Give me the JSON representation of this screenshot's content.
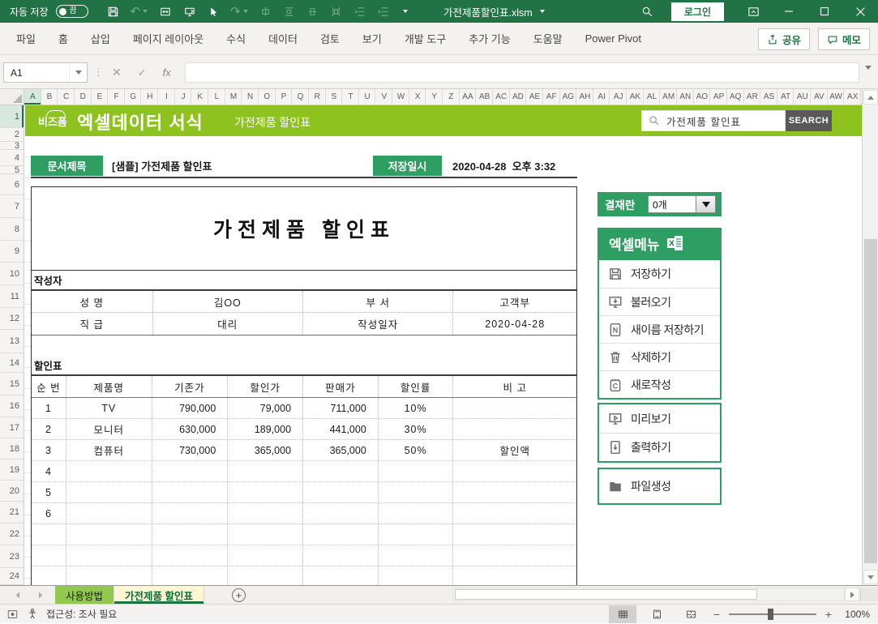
{
  "titlebar": {
    "autosave_label": "자동 저장",
    "autosave_state": "끔",
    "filename": "가전제품할인표.xlsm",
    "login_label": "로그인"
  },
  "ribbon": {
    "tabs": [
      "파일",
      "홈",
      "삽입",
      "페이지 레이아웃",
      "수식",
      "데이터",
      "검토",
      "보기",
      "개발 도구",
      "추가 기능",
      "도움말",
      "Power Pivot"
    ],
    "share_label": "공유",
    "memo_label": "메모"
  },
  "formula_bar": {
    "name_box": "A1",
    "fx_label": "fx",
    "formula_value": ""
  },
  "grid": {
    "columns": [
      "A",
      "B",
      "C",
      "D",
      "E",
      "F",
      "G",
      "H",
      "I",
      "J",
      "K",
      "L",
      "M",
      "N",
      "O",
      "P",
      "Q",
      "R",
      "S",
      "T",
      "U",
      "V",
      "W",
      "X",
      "Y",
      "Z",
      "AA",
      "AB",
      "AC",
      "AD",
      "AE",
      "AF",
      "AG",
      "AH",
      "AI",
      "AJ",
      "AK",
      "AL",
      "AM",
      "AN",
      "AO",
      "AP",
      "AQ",
      "AR",
      "AS",
      "AT",
      "AU",
      "AV",
      "AW",
      "AX"
    ],
    "rows": [
      "1",
      "2",
      "3",
      "4",
      "5",
      "6",
      "7",
      "8",
      "9",
      "10",
      "11",
      "12",
      "13",
      "14",
      "15",
      "16",
      "17",
      "18",
      "19",
      "20",
      "21",
      "22",
      "23",
      "24"
    ],
    "selected_column": "A",
    "selected_row": "1"
  },
  "banner": {
    "logo": "비즈폼",
    "title": "엑셀데이터 서식",
    "subtitle": "가전제품 할인표",
    "search_value": "가전제품 할인표",
    "search_button": "SEARCH",
    "color": "#8dc21f"
  },
  "doc_header": {
    "title_label": "문서제목",
    "title_value": "[샘플] 가전제품 할인표",
    "saved_label": "저장일시",
    "saved_value": "2020-04-28  오후 3:32",
    "badge_color": "#2f9e62"
  },
  "content": {
    "main_title": "가전제품 할인표",
    "author_section_label": "작성자",
    "author_table": {
      "rows": [
        [
          "성  명",
          "김OO",
          "부  서",
          "고객부"
        ],
        [
          "직  급",
          "대리",
          "작성일자",
          "2020-04-28"
        ]
      ]
    },
    "discount_section_label": "할인표",
    "discount_table": {
      "headers": [
        "순 번",
        "제품명",
        "기존가",
        "할인가",
        "판매가",
        "할인률",
        "비 고"
      ],
      "rows": [
        [
          "1",
          "TV",
          "790,000",
          "79,000",
          "711,000",
          "10%",
          ""
        ],
        [
          "2",
          "모니터",
          "630,000",
          "189,000",
          "441,000",
          "30%",
          ""
        ],
        [
          "3",
          "컴퓨터",
          "730,000",
          "365,000",
          "365,000",
          "50%",
          "할인액"
        ],
        [
          "4",
          "",
          "",
          "",
          "",
          "",
          ""
        ],
        [
          "5",
          "",
          "",
          "",
          "",
          "",
          ""
        ],
        [
          "6",
          "",
          "",
          "",
          "",
          "",
          ""
        ],
        [
          "",
          "",
          "",
          "",
          "",
          "",
          ""
        ],
        [
          "",
          "",
          "",
          "",
          "",
          "",
          ""
        ],
        [
          "",
          "",
          "",
          "",
          "",
          "",
          ""
        ]
      ]
    }
  },
  "sidebar": {
    "approval": {
      "label": "결재란",
      "count": "0개"
    },
    "menu_title": "엑셀메뉴",
    "menu_groups": [
      {
        "items": [
          {
            "label": "저장하기",
            "icon": "save-icon"
          },
          {
            "label": "불러오기",
            "icon": "load-icon"
          },
          {
            "label": "새이름 저장하기",
            "icon": "save-as-icon"
          },
          {
            "label": "삭제하기",
            "icon": "delete-icon"
          },
          {
            "label": "새로작성",
            "icon": "new-doc-icon"
          }
        ]
      },
      {
        "items": [
          {
            "label": "미리보기",
            "icon": "preview-icon"
          },
          {
            "label": "출력하기",
            "icon": "print-icon"
          }
        ]
      },
      {
        "items": [
          {
            "label": "파일생성",
            "icon": "file-create-icon"
          }
        ]
      }
    ],
    "accent_color": "#2f9e62"
  },
  "sheet_tabs": {
    "tabs": [
      {
        "label": "사용방법",
        "active": false
      },
      {
        "label": "가전제품 할인표",
        "active": true
      }
    ]
  },
  "status_bar": {
    "accessibility": "접근성: 조사 필요",
    "zoom": "100%"
  }
}
